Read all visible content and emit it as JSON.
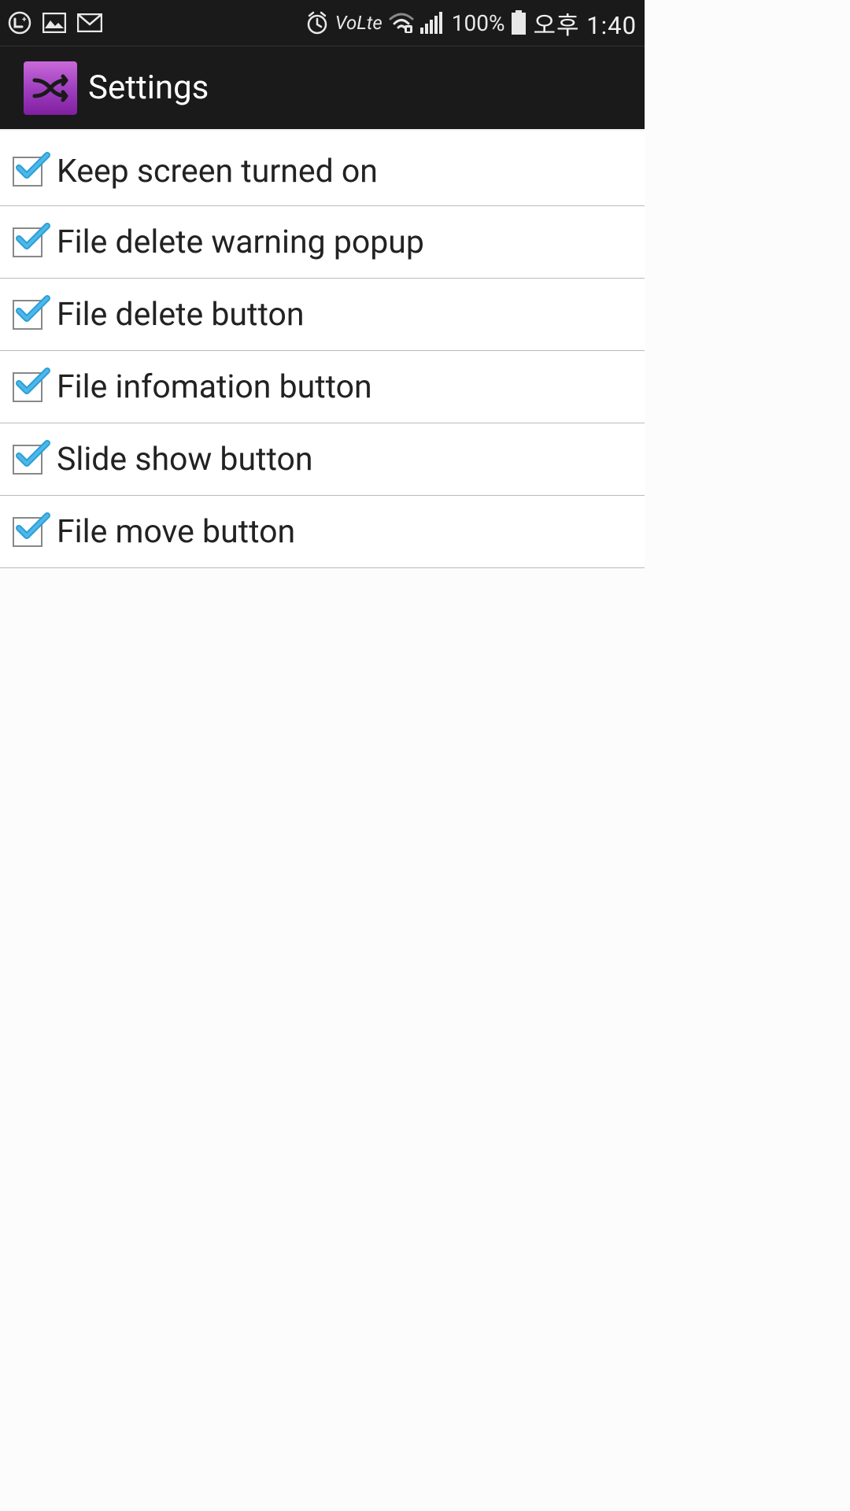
{
  "status_bar": {
    "battery_percent": "100%",
    "time": "오후 1:40",
    "volte": "VoLte"
  },
  "header": {
    "title": "Settings"
  },
  "settings": [
    {
      "label": "Keep screen turned on",
      "checked": true
    },
    {
      "label": "File delete warning popup",
      "checked": true
    },
    {
      "label": "File delete button",
      "checked": true
    },
    {
      "label": "File infomation button",
      "checked": true
    },
    {
      "label": "Slide show button",
      "checked": true
    },
    {
      "label": "File move button",
      "checked": true
    }
  ]
}
